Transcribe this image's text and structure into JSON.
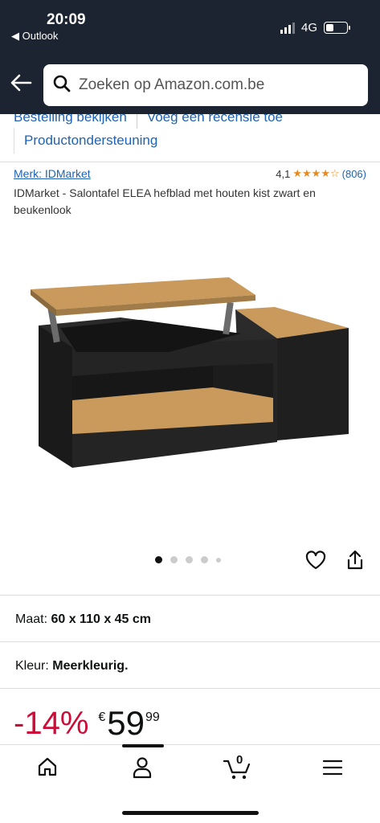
{
  "status": {
    "time": "20:09",
    "back_app": "◀ Outlook",
    "network": "4G"
  },
  "search": {
    "placeholder": "Zoeken op Amazon.com.be"
  },
  "links": {
    "order": "Bestelling bekijken",
    "review": "Voeg een recensie toe",
    "support": "Productondersteuning"
  },
  "product": {
    "brand": "Merk: IDMarket",
    "rating": "4,1",
    "stars": "★★★★☆",
    "review_count": "(806)",
    "title": "IDMarket - Salontafel ELEA hefblad met houten kist zwart en beukenlook",
    "image_count": 5,
    "active_image": 0
  },
  "attributes": {
    "size_label": "Maat:",
    "size_value": "60 x 110 x 45 cm",
    "color_label": "Kleur:",
    "color_value": "Meerkleurig."
  },
  "price": {
    "discount": "-14%",
    "currency": "€",
    "whole": "59",
    "fraction": "99"
  },
  "cart": {
    "count": "0"
  },
  "colors": {
    "header": "#1c2431",
    "link": "#1e63b5",
    "discount": "#cc0c39",
    "star": "#e88a1a"
  }
}
